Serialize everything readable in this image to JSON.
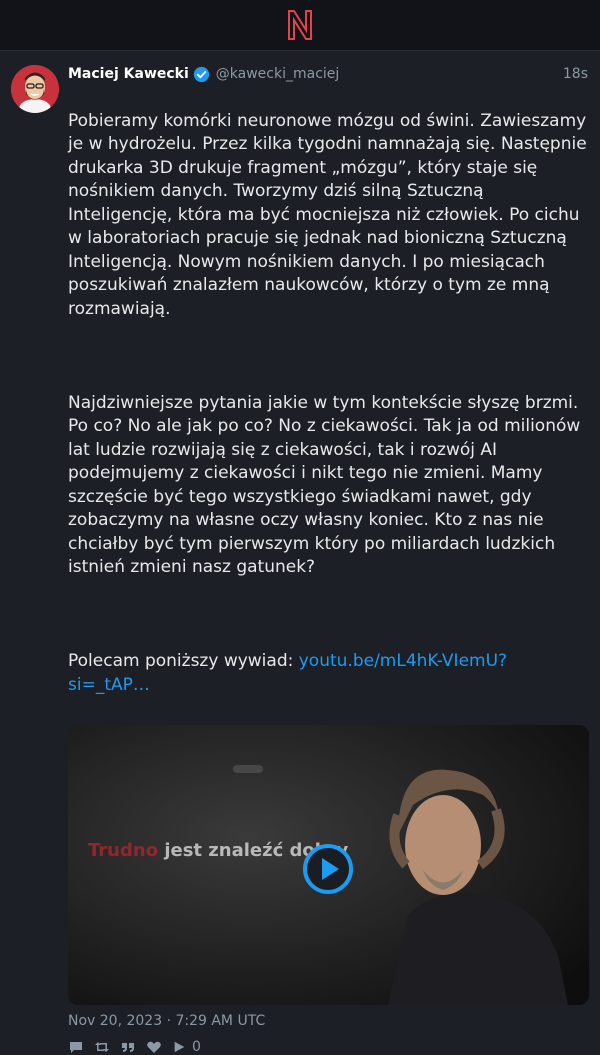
{
  "tweet": {
    "author_name": "Maciej Kawecki",
    "handle": "@kawecki_maciej",
    "time": "18s",
    "text_p1": "Pobieramy komórki neuronowe mózgu od świni. Zawieszamy je w hydrożelu. Przez kilka tygodni namnażają się. Następnie drukarka 3D drukuje fragment „mózgu”, który staje się nośnikiem danych. Tworzymy dziś silną Sztuczną Inteligencję, która ma być mocniejsza niż człowiek. Po cichu w laboratoriach pracuje się jednak nad bioniczną Sztuczną Inteligencją. Nowym nośnikiem danych. I po miesiącach poszukiwań znalazłem naukowców, którzy o tym ze mną rozmawiają.",
    "text_p2": "Najdziwniejsze pytania jakie w tym kontekście słyszę brzmi. Po co? No ale jak po co? No z ciekawości. Tak ja od milionów lat ludzie rozwijają się z ciekawości, tak i rozwój AI podejmujemy z ciekawości i nikt tego nie zmieni. Mamy szczęście być tego wszystkiego świadkami nawet, gdy zobaczymy na własne oczy własny koniec. Kto z nas nie chciałby być tym pierwszym który po miliardach ludzkich istnień zmieni nasz gatunek?",
    "text_p3_prefix": "Polecam poniższy wywiad: ",
    "link_text": "youtu.be/mL4hK-VIemU?si=_tAP…",
    "video_caption_red": "Trudno",
    "video_caption_rest": " jest znaleźć dobry",
    "date": "Nov 20, 2023 · 7:29 AM UTC",
    "views": "0"
  },
  "colors": {
    "background": "#1c1f25",
    "topbar": "#111318",
    "accent": "#1d9bf0",
    "logo": "#e0454a",
    "muted": "#8b98a5"
  },
  "icons": [
    "nitter-logo",
    "verified-icon",
    "reply-icon",
    "retweet-icon",
    "quote-icon",
    "like-icon",
    "play-icon"
  ]
}
